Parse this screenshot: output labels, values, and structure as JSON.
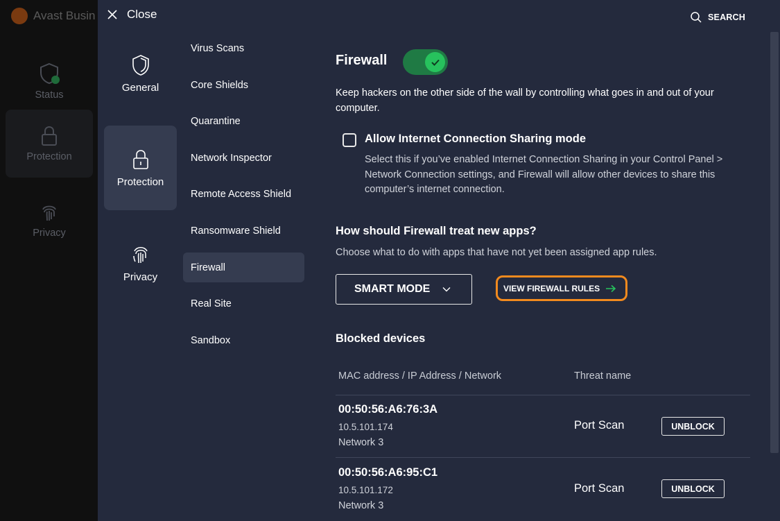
{
  "background_app": {
    "name": "Avast Busin",
    "nav": [
      {
        "label": "Status"
      },
      {
        "label": "Protection"
      },
      {
        "label": "Privacy"
      }
    ]
  },
  "header": {
    "close_label": "Close",
    "search_label": "SEARCH"
  },
  "categories": [
    {
      "label": "General",
      "icon": "shield-icon"
    },
    {
      "label": "Protection",
      "icon": "lock-icon",
      "active": true
    },
    {
      "label": "Privacy",
      "icon": "fingerprint-icon"
    }
  ],
  "submenu": [
    {
      "label": "Virus Scans"
    },
    {
      "label": "Core Shields"
    },
    {
      "label": "Quarantine"
    },
    {
      "label": "Network Inspector"
    },
    {
      "label": "Remote Access Shield"
    },
    {
      "label": "Ransomware Shield"
    },
    {
      "label": "Firewall",
      "active": true
    },
    {
      "label": "Real Site"
    },
    {
      "label": "Sandbox"
    }
  ],
  "firewall": {
    "title": "Firewall",
    "enabled": true,
    "description": "Keep hackers on the other side of the wall by controlling what goes in and out of your computer.",
    "ics": {
      "label": "Allow Internet Connection Sharing mode",
      "checked": false,
      "description": "Select this if you’ve enabled Internet Connection Sharing in your Control Panel > Network Connection settings, and Firewall will allow other devices to share this computer’s internet connection."
    },
    "new_apps": {
      "title": "How should Firewall treat new apps?",
      "description": "Choose what to do with apps that have not yet been assigned app rules.",
      "mode": "SMART MODE",
      "rules_link": "VIEW FIREWALL RULES"
    },
    "blocked": {
      "title": "Blocked devices",
      "columns": [
        "MAC address / IP Address / Network",
        "Threat name"
      ],
      "rows": [
        {
          "mac": "00:50:56:A6:76:3A",
          "ip": "10.5.101.174",
          "network": "Network 3",
          "threat": "Port Scan",
          "action": "UNBLOCK"
        },
        {
          "mac": "00:50:56:A6:95:C1",
          "ip": "10.5.101.172",
          "network": "Network 3",
          "threat": "Port Scan",
          "action": "UNBLOCK"
        }
      ]
    }
  },
  "colors": {
    "panel_bg": "#242a3d",
    "active_item_bg": "#353c50",
    "toggle_on": "#27c25d",
    "highlight_orange": "#f28a1e"
  }
}
